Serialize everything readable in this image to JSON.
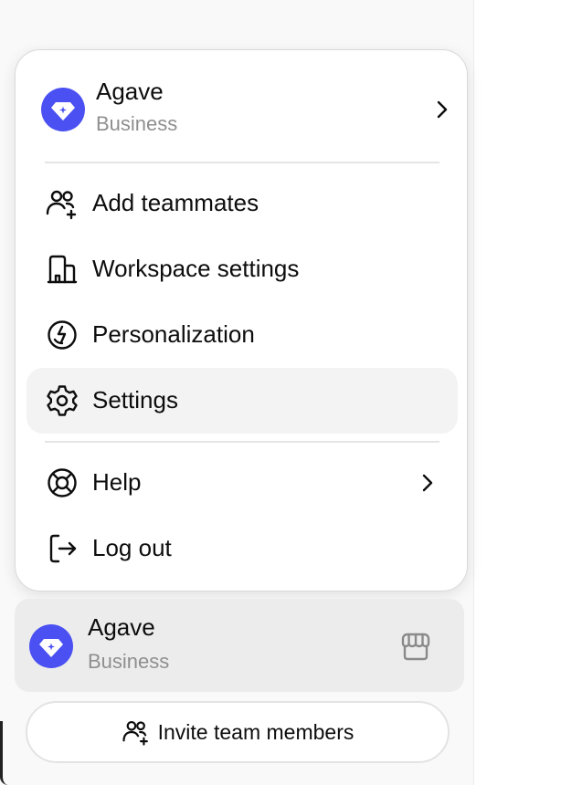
{
  "menu": {
    "workspace": {
      "name": "Agave",
      "plan": "Business",
      "avatar_color": "#4a50f2",
      "icon": "diamond-icon"
    },
    "items": [
      {
        "label": "Add teammates",
        "icon": "add-teammates-icon"
      },
      {
        "label": "Workspace settings",
        "icon": "building-icon"
      },
      {
        "label": "Personalization",
        "icon": "personalization-icon"
      },
      {
        "label": "Settings",
        "icon": "gear-icon",
        "highlighted": true
      },
      {
        "label": "Help",
        "icon": "lifebuoy-icon",
        "has_submenu": true
      },
      {
        "label": "Log out",
        "icon": "log-out-icon"
      }
    ]
  },
  "sidebar_footer": {
    "workspace": {
      "name": "Agave",
      "plan": "Business",
      "icon": "diamond-icon",
      "action_icon": "store-icon"
    },
    "invite_button": {
      "label": "Invite team members",
      "icon": "add-teammates-icon"
    }
  },
  "colors": {
    "accent": "#4a50f2",
    "highlight": "#f3f3f3",
    "secondary_text": "#8f8f8f"
  }
}
